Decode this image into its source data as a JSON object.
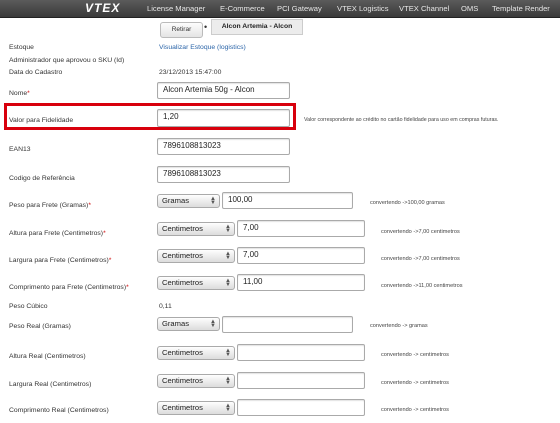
{
  "topbar": {
    "logo": "VTEX",
    "nav": [
      "License Manager",
      "E-Commerce",
      "PCI Gateway",
      "VTEX Logistics",
      "VTEX Channel",
      "OMS",
      "Template Render"
    ]
  },
  "toolbar": {
    "retirar_label": "Retirar",
    "product_tab": "Alcon Artemia - Alcon"
  },
  "fields": {
    "estoque": {
      "label": "Estoque",
      "link": "Visualizar Estoque (logistics)"
    },
    "admin": {
      "label": "Administrador que aprovou o SKU (Id)"
    },
    "data_cadastro": {
      "label": "Data do Cadastro",
      "value": "23/12/2013 15:47:00"
    },
    "nome": {
      "label": "Nome",
      "value": "Alcon Artemia 50g - Alcon"
    },
    "fidelidade": {
      "label": "Valor para Fidelidade",
      "value": "1,20",
      "hint": "Valor correspondente ao crédito no cartão fidelidade para uso em compras futuras."
    },
    "ean13": {
      "label": "EAN13",
      "value": "7896108813023"
    },
    "codigo": {
      "label": "Codigo de Referência",
      "value": "7896108813023"
    },
    "peso_frete": {
      "label": "Peso para Frete (Gramas)",
      "unit": "Gramas",
      "value": "100,00",
      "hint": "convertendo ->100,00 gramas"
    },
    "altura_frete": {
      "label": "Altura para Frete (Centimetros)",
      "unit": "Centimetros",
      "value": "7,00",
      "hint": "convertendo ->7,00 centimetros"
    },
    "largura_frete": {
      "label": "Largura para Frete (Centimetros)",
      "unit": "Centimetros",
      "value": "7,00",
      "hint": "convertendo ->7,00 centimetros"
    },
    "comprimento_frete": {
      "label": "Comprimento para Frete (Centimetros)",
      "unit": "Centimetros",
      "value": "11,00",
      "hint": "convertendo ->11,00 centimetros"
    },
    "peso_cubico": {
      "label": "Peso Cúbico",
      "value": "0,11"
    },
    "peso_real": {
      "label": "Peso Real (Gramas)",
      "unit": "Gramas",
      "value": "",
      "hint": "convertendo -> gramas"
    },
    "altura_real": {
      "label": "Altura Real (Centimetros)",
      "unit": "Centimetros",
      "value": "",
      "hint": "convertendo -> centimetros"
    },
    "largura_real": {
      "label": "Largura Real (Centimetros)",
      "unit": "Centimetros",
      "value": "",
      "hint": "convertendo -> centimetros"
    },
    "comprimento_real": {
      "label": "Comprimento Real (Centimetros)",
      "unit": "Centimetros",
      "value": "",
      "hint": "convertendo -> centimetros"
    }
  },
  "required_mark": "*",
  "colors": {
    "highlight": "#d8000c",
    "link": "#2a64a8",
    "required": "#cc0000"
  }
}
